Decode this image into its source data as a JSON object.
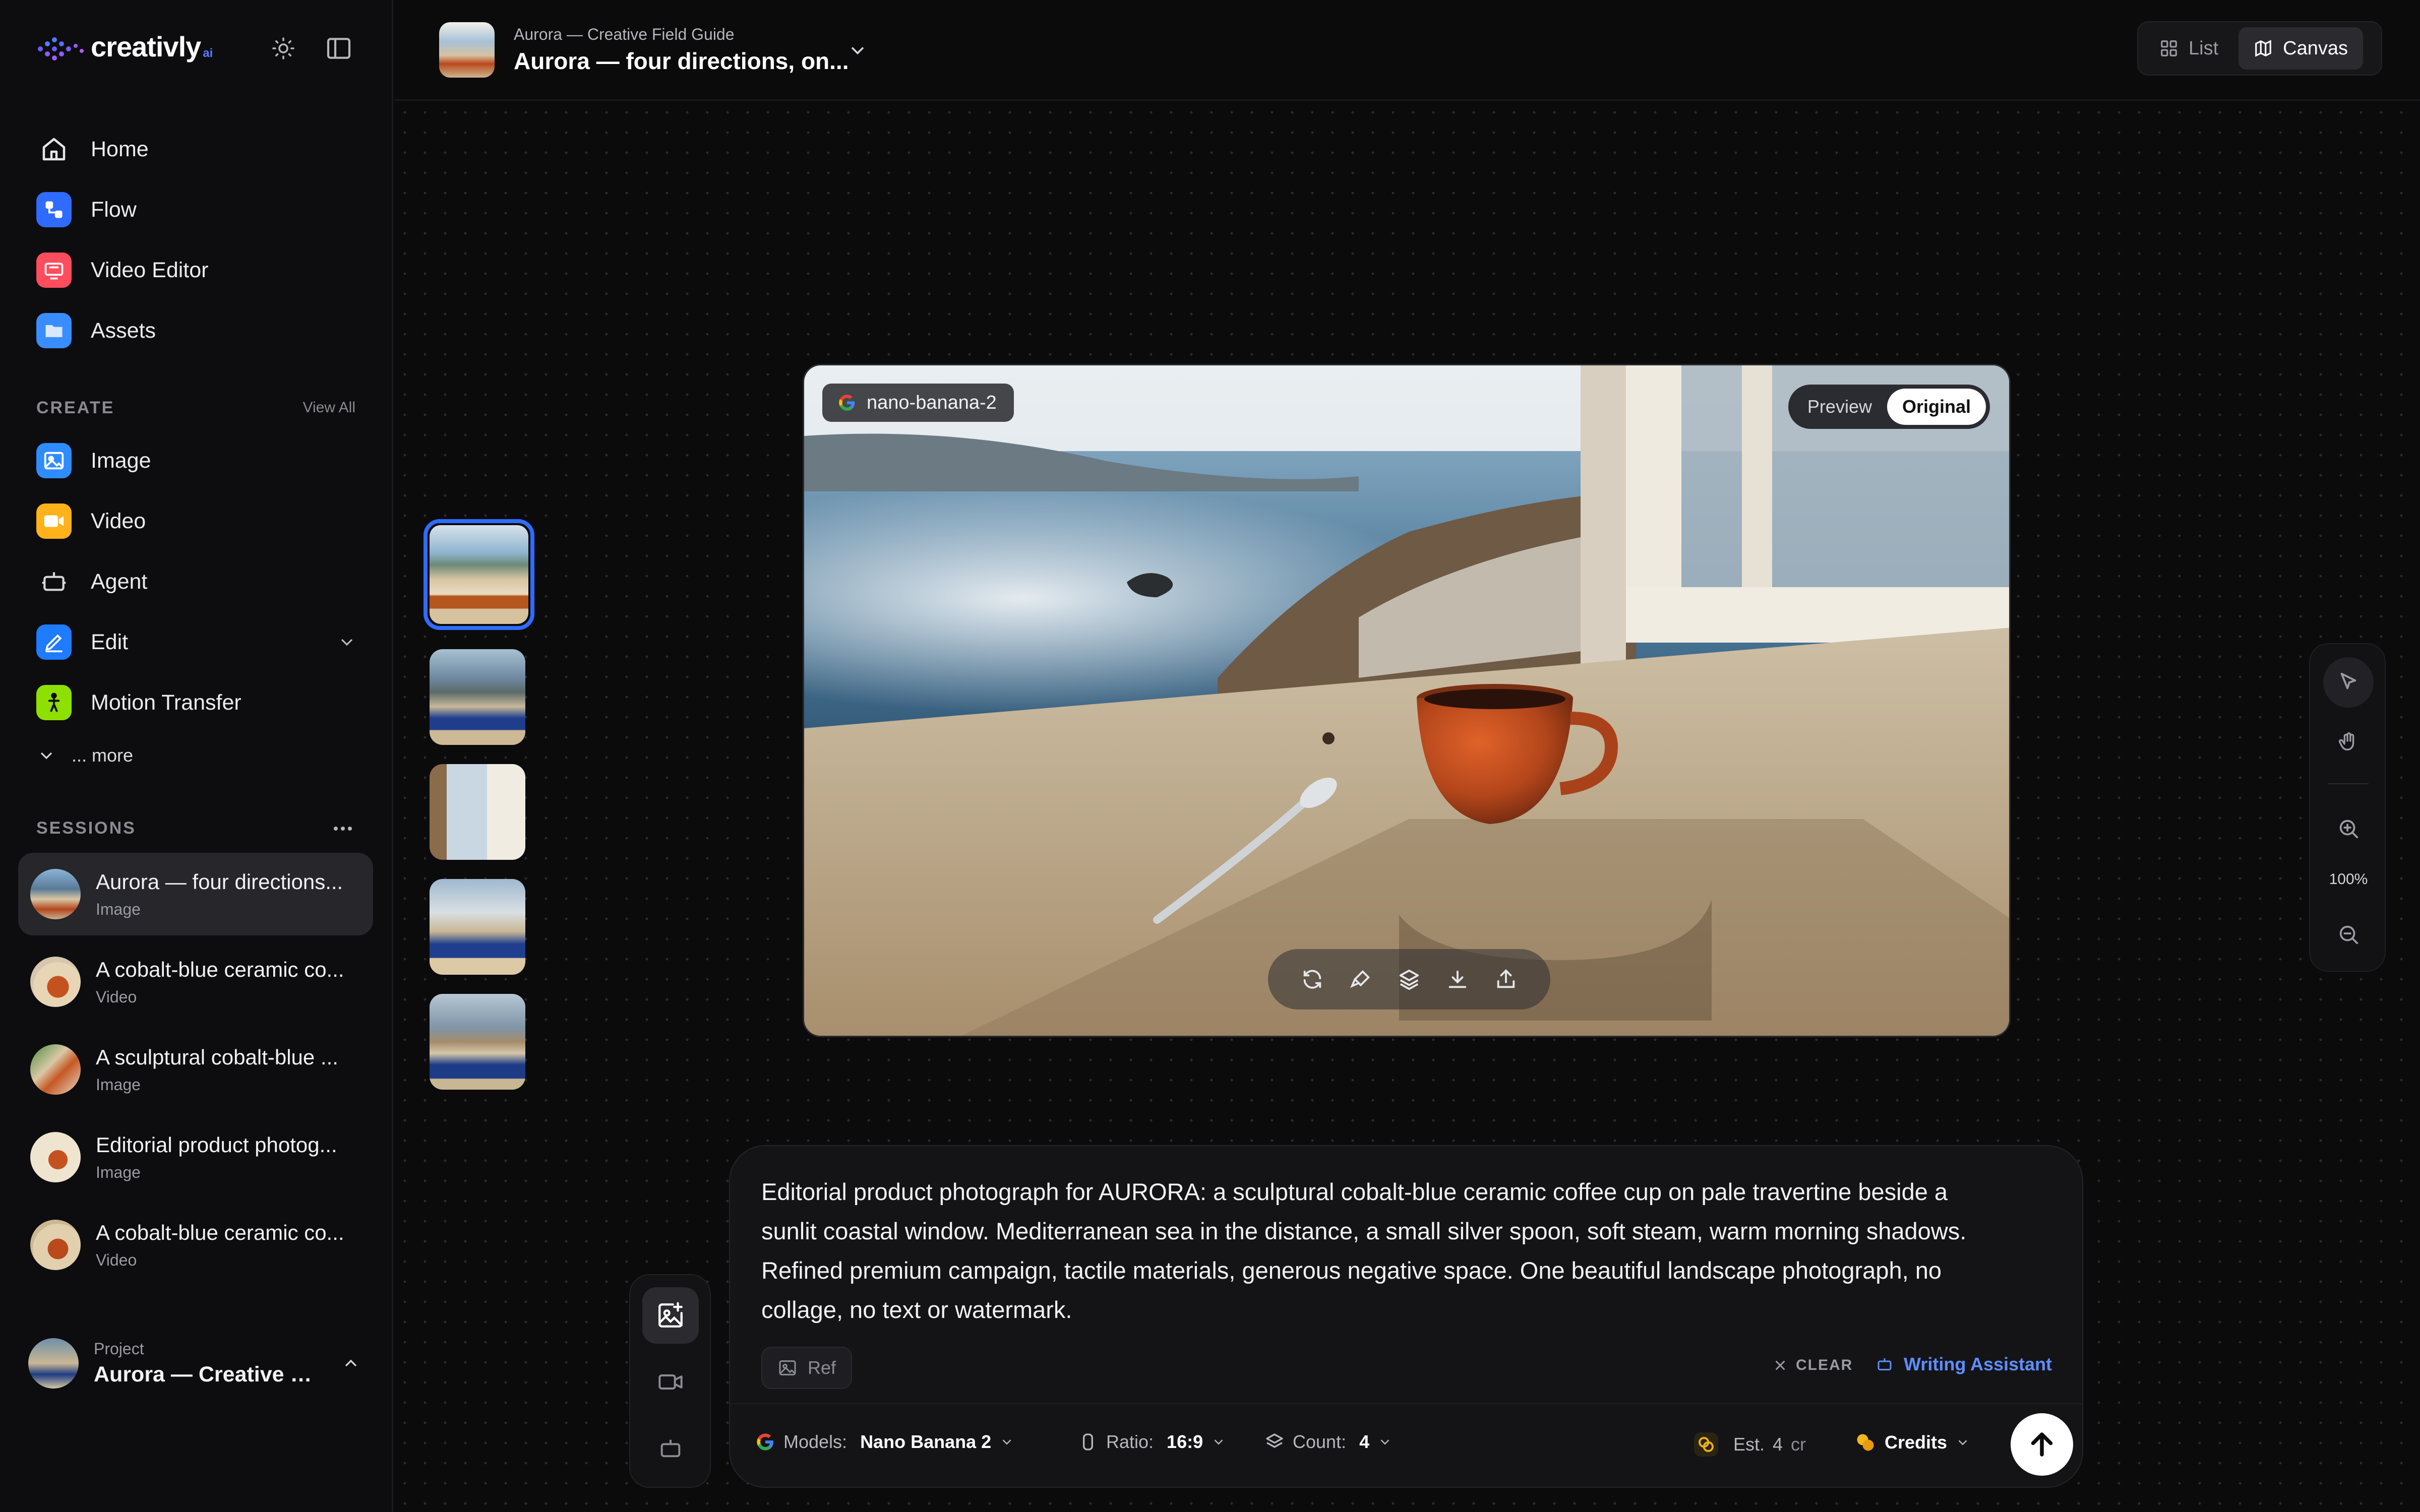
{
  "brand": {
    "name": "creativly",
    "suffix": "ai"
  },
  "sidebar": {
    "main_nav": [
      {
        "label": "Home",
        "icon": "home-icon"
      },
      {
        "label": "Flow",
        "icon": "flow-icon"
      },
      {
        "label": "Video Editor",
        "icon": "video-editor-icon"
      },
      {
        "label": "Assets",
        "icon": "folder-icon"
      }
    ],
    "create_label": "CREATE",
    "view_all_label": "View All",
    "create_items": [
      {
        "label": "Image",
        "icon": "image-icon"
      },
      {
        "label": "Video",
        "icon": "video-icon"
      },
      {
        "label": "Agent",
        "icon": "robot-icon"
      },
      {
        "label": "Edit",
        "icon": "pen-icon"
      },
      {
        "label": "Motion Transfer",
        "icon": "person-icon"
      }
    ],
    "more_label": "... more",
    "sessions_label": "SESSIONS",
    "sessions": [
      {
        "title": "Aurora — four directions...",
        "type": "Image"
      },
      {
        "title": "A cobalt-blue ceramic co...",
        "type": "Video"
      },
      {
        "title": "A sculptural cobalt-blue ...",
        "type": "Image"
      },
      {
        "title": "Editorial product photog...",
        "type": "Image"
      },
      {
        "title": "A cobalt-blue ceramic co...",
        "type": "Video"
      }
    ],
    "project": {
      "label": "Project",
      "name": "Aurora — Creative Fi..."
    }
  },
  "header": {
    "subtitle": "Aurora — Creative Field Guide",
    "title": "Aurora — four directions, on...",
    "view_list": "List",
    "view_canvas": "Canvas"
  },
  "canvas": {
    "model_badge": "nano-banana-2",
    "preview_label": "Preview",
    "original_label": "Original",
    "zoom_level": "100%",
    "thumbnail_count": 5
  },
  "composer": {
    "prompt": "Editorial product photograph for AURORA: a sculptural cobalt-blue ceramic coffee cup on pale travertine beside a sunlit coastal window. Mediterranean sea in the distance, a small silver spoon, soft steam, warm morning shadows. Refined premium campaign, tactile materials, generous negative space. One beautiful landscape photograph, no collage, no text or watermark.",
    "ref_label": "Ref",
    "clear_label": "CLEAR",
    "writing_assistant_label": "Writing Assistant",
    "models_label": "Models:",
    "models_value": "Nano Banana 2",
    "ratio_label": "Ratio:",
    "ratio_value": "16:9",
    "count_label": "Count:",
    "count_value": "4",
    "est_label": "Est.",
    "est_value": "4",
    "est_unit": "cr",
    "credits_label": "Credits"
  },
  "colors": {
    "accent": "#2f6bff",
    "link": "#5e8eff",
    "background": "#0b0b0c"
  }
}
